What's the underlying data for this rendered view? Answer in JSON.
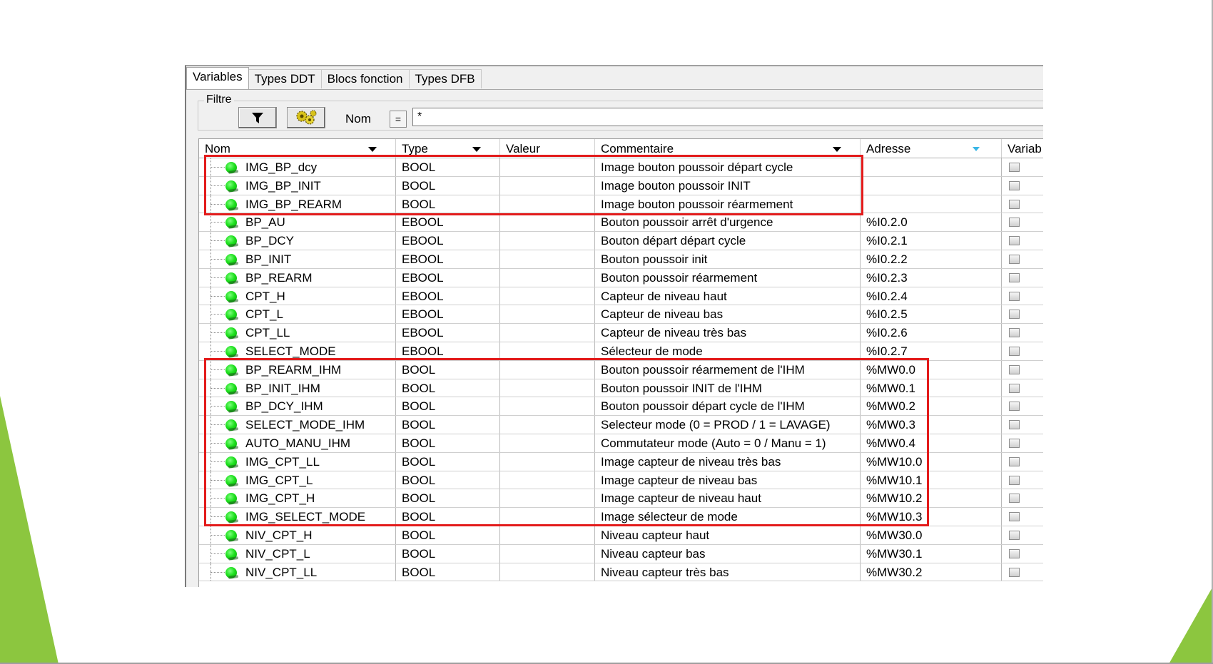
{
  "colors": {
    "highlight": "#e31b1b",
    "status_dot": "#1ee01e",
    "slide_accent": "#8cc63f"
  },
  "tabs": [
    {
      "label": "Variables",
      "active": true
    },
    {
      "label": "Types DDT",
      "active": false
    },
    {
      "label": "Blocs fonction",
      "active": false
    },
    {
      "label": "Types DFB",
      "active": false
    }
  ],
  "filter": {
    "legend": "Filtre",
    "filter_icon": "funnel-icon",
    "refresh_icon": "gear-cluster-icon",
    "nom_label": "Nom",
    "eq_label": "=",
    "value": "*"
  },
  "columns": {
    "nom": "Nom",
    "type": "Type",
    "valeur": "Valeur",
    "commentaire": "Commentaire",
    "adresse": "Adresse",
    "variable": "Variab"
  },
  "rows": [
    {
      "name": "IMG_BP_dcy",
      "type": "BOOL",
      "value": "",
      "comment": "Image bouton poussoir départ cycle",
      "address": ""
    },
    {
      "name": "IMG_BP_INIT",
      "type": "BOOL",
      "value": "",
      "comment": "Image bouton poussoir INIT",
      "address": ""
    },
    {
      "name": "IMG_BP_REARM",
      "type": "BOOL",
      "value": "",
      "comment": "Image bouton poussoir réarmement",
      "address": ""
    },
    {
      "name": "BP_AU",
      "type": "EBOOL",
      "value": "",
      "comment": "Bouton poussoir arrêt d'urgence",
      "address": "%I0.2.0"
    },
    {
      "name": "BP_DCY",
      "type": "EBOOL",
      "value": "",
      "comment": "Bouton départ départ cycle",
      "address": "%I0.2.1"
    },
    {
      "name": "BP_INIT",
      "type": "EBOOL",
      "value": "",
      "comment": "Bouton poussoir init",
      "address": "%I0.2.2"
    },
    {
      "name": "BP_REARM",
      "type": "EBOOL",
      "value": "",
      "comment": "Bouton poussoir réarmement",
      "address": "%I0.2.3"
    },
    {
      "name": "CPT_H",
      "type": "EBOOL",
      "value": "",
      "comment": "Capteur de niveau haut",
      "address": "%I0.2.4"
    },
    {
      "name": "CPT_L",
      "type": "EBOOL",
      "value": "",
      "comment": "Capteur de niveau bas",
      "address": "%I0.2.5"
    },
    {
      "name": "CPT_LL",
      "type": "EBOOL",
      "value": "",
      "comment": "Capteur de niveau très bas",
      "address": "%I0.2.6"
    },
    {
      "name": "SELECT_MODE",
      "type": "EBOOL",
      "value": "",
      "comment": "Sélecteur de mode",
      "address": "%I0.2.7"
    },
    {
      "name": "BP_REARM_IHM",
      "type": "BOOL",
      "value": "",
      "comment": "Bouton poussoir réarmement de l'IHM",
      "address": "%MW0.0"
    },
    {
      "name": "BP_INIT_IHM",
      "type": "BOOL",
      "value": "",
      "comment": "Bouton poussoir INIT de l'IHM",
      "address": "%MW0.1"
    },
    {
      "name": "BP_DCY_IHM",
      "type": "BOOL",
      "value": "",
      "comment": "Bouton poussoir départ cycle de l'IHM",
      "address": "%MW0.2"
    },
    {
      "name": "SELECT_MODE_IHM",
      "type": "BOOL",
      "value": "",
      "comment": "Selecteur mode (0 = PROD / 1 = LAVAGE)",
      "address": "%MW0.3"
    },
    {
      "name": "AUTO_MANU_IHM",
      "type": "BOOL",
      "value": "",
      "comment": "Commutateur mode (Auto = 0 / Manu = 1)",
      "address": "%MW0.4"
    },
    {
      "name": "IMG_CPT_LL",
      "type": "BOOL",
      "value": "",
      "comment": "Image capteur de niveau très bas",
      "address": "%MW10.0"
    },
    {
      "name": "IMG_CPT_L",
      "type": "BOOL",
      "value": "",
      "comment": "Image capteur de niveau bas",
      "address": "%MW10.1"
    },
    {
      "name": "IMG_CPT_H",
      "type": "BOOL",
      "value": "",
      "comment": "Image capteur de niveau haut",
      "address": "%MW10.2"
    },
    {
      "name": "IMG_SELECT_MODE",
      "type": "BOOL",
      "value": "",
      "comment": "Image sélecteur de mode",
      "address": "%MW10.3"
    },
    {
      "name": "NIV_CPT_H",
      "type": "BOOL",
      "value": "",
      "comment": "Niveau capteur haut",
      "address": "%MW30.0"
    },
    {
      "name": "NIV_CPT_L",
      "type": "BOOL",
      "value": "",
      "comment": "Niveau capteur bas",
      "address": "%MW30.1"
    },
    {
      "name": "NIV_CPT_LL",
      "type": "BOOL",
      "value": "",
      "comment": "Niveau capteur très bas",
      "address": "%MW30.2"
    }
  ]
}
